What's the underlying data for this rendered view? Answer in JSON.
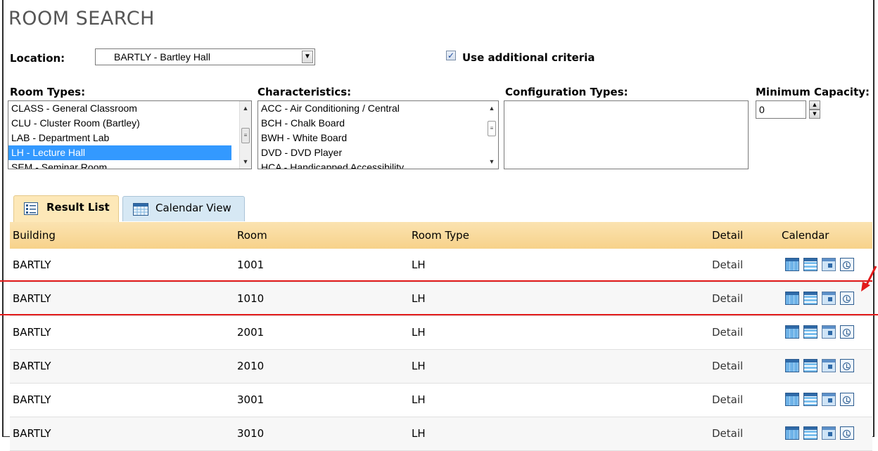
{
  "page": {
    "title": "ROOM SEARCH"
  },
  "location": {
    "label": "Location:",
    "value": "BARTLY - Bartley Hall"
  },
  "criteria": {
    "label": "Use additional criteria",
    "checked": true
  },
  "room_types": {
    "label": "Room Types:",
    "options": [
      "CLASS - General Classroom",
      "CLU - Cluster Room (Bartley)",
      "LAB - Department Lab",
      "LH - Lecture Hall",
      "SEM - Seminar Room"
    ],
    "selected": "LH - Lecture Hall"
  },
  "characteristics": {
    "label": "Characteristics:",
    "options": [
      "ACC - Air Conditioning / Central",
      "BCH - Chalk Board",
      "BWH - White Board",
      "DVD - DVD Player",
      "HCA - Handicapped Accessibility"
    ]
  },
  "configuration": {
    "label": "Configuration Types:",
    "options": []
  },
  "capacity": {
    "label": "Minimum Capacity:",
    "value": "0"
  },
  "tabs": [
    {
      "label": "Result List",
      "active": true
    },
    {
      "label": "Calendar View",
      "active": false
    }
  ],
  "results": {
    "columns": [
      "Building",
      "Room",
      "Room Type",
      "Detail",
      "Calendar"
    ],
    "rows": [
      {
        "building": "BARTLY",
        "room": "1001",
        "type": "LH",
        "detail": "Detail"
      },
      {
        "building": "BARTLY",
        "room": "1010",
        "type": "LH",
        "detail": "Detail"
      },
      {
        "building": "BARTLY",
        "room": "2001",
        "type": "LH",
        "detail": "Detail"
      },
      {
        "building": "BARTLY",
        "room": "2010",
        "type": "LH",
        "detail": "Detail"
      },
      {
        "building": "BARTLY",
        "room": "3001",
        "type": "LH",
        "detail": "Detail"
      },
      {
        "building": "BARTLY",
        "room": "3010",
        "type": "LH",
        "detail": "Detail"
      }
    ]
  },
  "annotation": {
    "color": "#e21a1a",
    "highlighted_room": "1010"
  }
}
